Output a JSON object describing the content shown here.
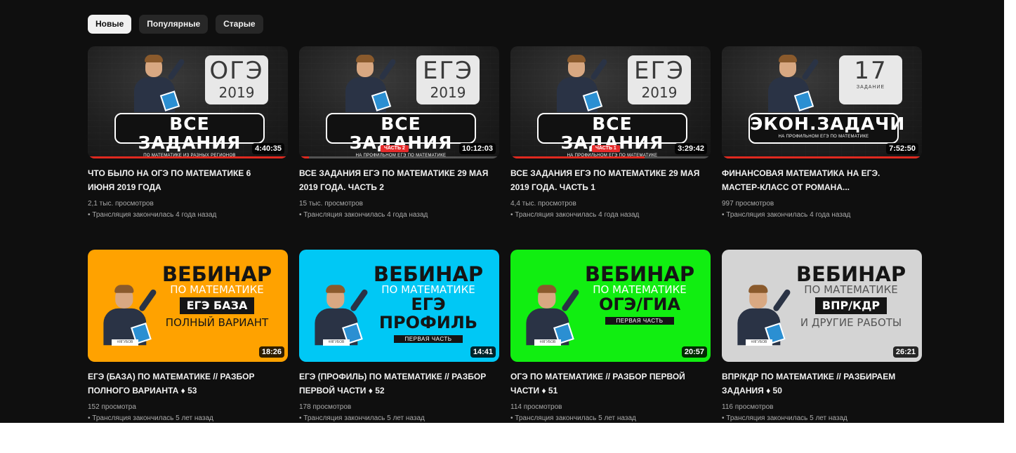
{
  "filters": [
    {
      "label": "Новые",
      "active": true
    },
    {
      "label": "Популярные",
      "active": false
    },
    {
      "label": "Старые",
      "active": false
    }
  ],
  "videos": [
    {
      "thumb_style": "dark",
      "badge_big": "ОГЭ",
      "badge_small": "2019",
      "banner_main": "ВСЕ ЗАДАНИЯ",
      "banner_sub": "ПО МАТЕМАТИКЕ ИЗ РАЗНЫХ РЕГИОНОВ",
      "part_tag": "",
      "duration": "4:40:35",
      "watched": 1.0,
      "title": "ЧТО БЫЛО НА ОГЭ ПО МАТЕМАТИКЕ 6 ИЮНЯ 2019 ГОДА",
      "views": "2,1 тыс. просмотров",
      "date": "• Трансляция закончилась 4 года назад"
    },
    {
      "thumb_style": "dark",
      "badge_big": "ЕГЭ",
      "badge_small": "2019",
      "banner_main": "ВСЕ ЗАДАНИЯ",
      "banner_sub": "НА ПРОФИЛЬНОМ ЕГЭ ПО МАТЕМАТИКЕ",
      "part_tag": "ЧАСТЬ 2",
      "duration": "10:12:03",
      "watched": 0.05,
      "title": "ВСЕ ЗАДАНИЯ ЕГЭ ПО МАТЕМАТИКЕ 29 МАЯ 2019 ГОДА. ЧАСТЬ 2",
      "views": "15 тыс. просмотров",
      "date": "• Трансляция закончилась 4 года назад"
    },
    {
      "thumb_style": "dark",
      "badge_big": "ЕГЭ",
      "badge_small": "2019",
      "banner_main": "ВСЕ ЗАДАНИЯ",
      "banner_sub": "НА ПРОФИЛЬНОМ ЕГЭ ПО МАТЕМАТИКЕ",
      "part_tag": "ЧАСТЬ 1",
      "duration": "3:29:42",
      "watched": 0.67,
      "title": "ВСЕ ЗАДАНИЯ ЕГЭ ПО МАТЕМАТИКЕ 29 МАЯ 2019 ГОДА. ЧАСТЬ 1",
      "views": "4,4 тыс. просмотров",
      "date": "• Трансляция закончилась 4 года назад"
    },
    {
      "thumb_style": "dark",
      "badge_big": "17",
      "badge_small": "",
      "badge_tiny": "ЗАДАНИЕ",
      "banner_main": "ЭКОН.ЗАДАЧИ",
      "banner_sub": "НА ПРОФИЛЬНОМ ЕГЭ ПО МАТЕМАТИКЕ",
      "part_tag": "",
      "duration": "7:52:50",
      "watched": 1.0,
      "title": "ФИНАНСОВАЯ МАТЕМАТИКА НА ЕГЭ. МАСТЕР-КЛАСС ОТ РОМАНА...",
      "views": "997 просмотров",
      "date": "• Трансляция закончилась 4 года назад"
    },
    {
      "thumb_style": "webinar",
      "bg": "#ffa200",
      "sub_color": "#ffffff",
      "web_title": "ВЕБИНАР",
      "web_sub": "ПО МАТЕМАТИКЕ",
      "web_ribbon": "ЕГЭ БАЗА",
      "web_strip": "",
      "web_foot": "ПОЛНЫЙ ВАРИАНТ",
      "stamp": "#ЯГУБОВ",
      "duration": "18:26",
      "watched": 0,
      "title": "ЕГЭ (БАЗА) ПО МАТЕМАТИКЕ // РАЗБОР ПОЛНОГО ВАРИАНТА ♦ 53",
      "views": "152 просмотра",
      "date": "• Трансляция закончилась 5 лет назад"
    },
    {
      "thumb_style": "webinar",
      "bg": "#00c8f5",
      "sub_color": "#ffffff",
      "web_title": "ВЕБИНАР",
      "web_sub": "ПО МАТЕМАТИКЕ",
      "web_ribbon_bare": "ЕГЭ ПРОФИЛЬ",
      "web_strip": "ПЕРВАЯ ЧАСТЬ",
      "web_foot": "",
      "stamp": "#ЯГУБОВ",
      "duration": "14:41",
      "watched": 0,
      "title": "ЕГЭ (ПРОФИЛЬ) ПО МАТЕМАТИКЕ // РАЗБОР ПЕРВОЙ ЧАСТИ ♦ 52",
      "views": "178 просмотров",
      "date": "• Трансляция закончилась 5 лет назад"
    },
    {
      "thumb_style": "webinar",
      "bg": "#11ee11",
      "sub_color": "#ffffff",
      "web_title": "ВЕБИНАР",
      "web_sub": "ПО МАТЕМАТИКЕ",
      "web_ribbon_bare": "ОГЭ/ГИА",
      "web_strip": "ПЕРВАЯ ЧАСТЬ",
      "web_foot": "",
      "stamp": "#ЯГУБОВ",
      "duration": "20:57",
      "watched": 0,
      "title": "ОГЭ ПО МАТЕМАТИКЕ // РАЗБОР ПЕРВОЙ ЧАСТИ ♦ 51",
      "views": "114 просмотров",
      "date": "• Трансляция закончилась 5 лет назад"
    },
    {
      "thumb_style": "webinar",
      "bg": "#d4d4d4",
      "sub_color": "#555555",
      "web_title": "ВЕБИНАР",
      "web_sub": "ПО МАТЕМАТИКЕ",
      "web_ribbon": "ВПР/КДР",
      "web_strip": "",
      "web_foot": "И ДРУГИЕ РАБОТЫ",
      "stamp": "#ЯГУБОВ",
      "duration": "26:21",
      "watched": 0,
      "title": "ВПР/КДР ПО МАТЕМАТИКЕ // РАЗБИРАЕМ ЗАДАНИЯ ♦ 50",
      "views": "116 просмотров",
      "date": "• Трансляция закончилась 5 лет назад"
    }
  ]
}
